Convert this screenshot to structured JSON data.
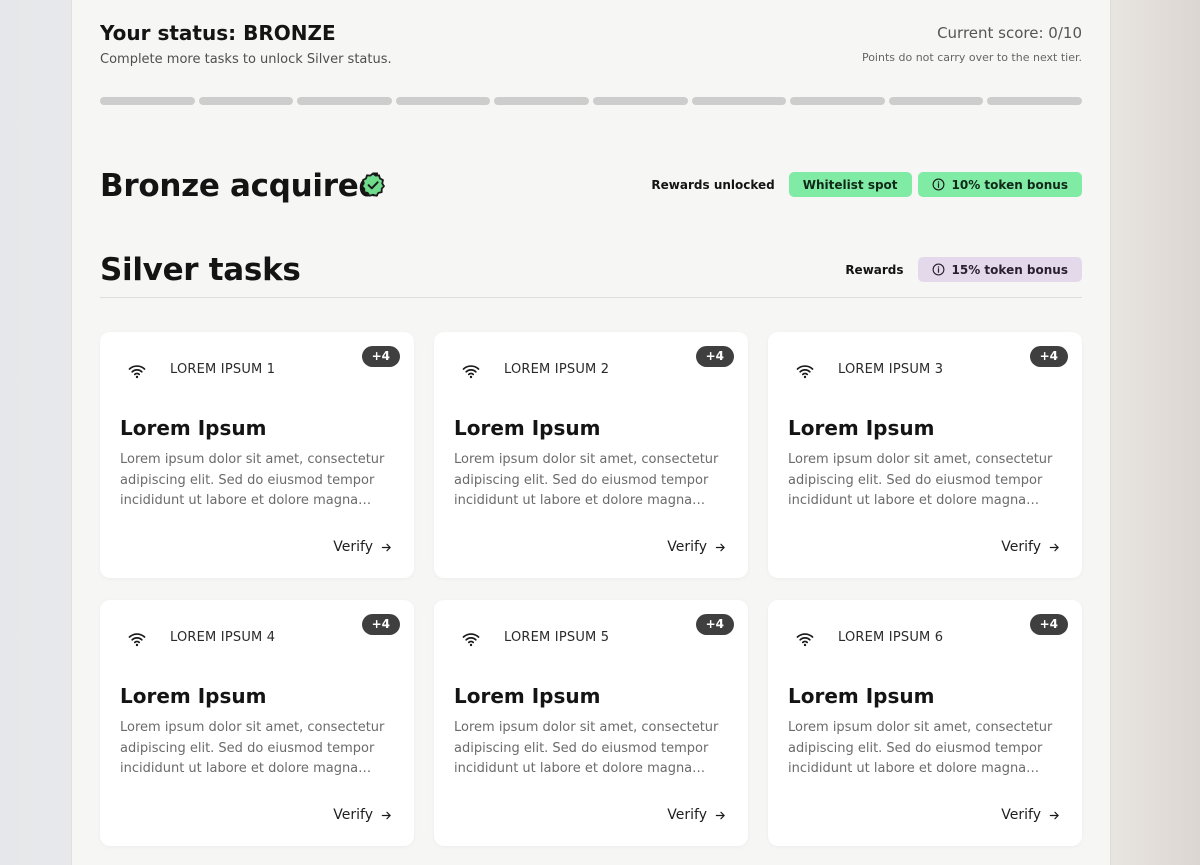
{
  "status": {
    "title": "Your status: BRONZE",
    "subtitle": "Complete more tasks to unlock Silver status.",
    "score": "Current score: 0/10",
    "note": "Points do not carry over to the next tier.",
    "progress": {
      "filled": 0,
      "total": 10
    }
  },
  "bronze": {
    "title": "Bronze acquired",
    "rewards_label": "Rewards unlocked",
    "rewards": [
      "Whitelist spot",
      "10% token bonus"
    ]
  },
  "silver": {
    "title": "Silver tasks",
    "rewards_label": "Rewards",
    "reward": "15% token bonus"
  },
  "tasks": [
    {
      "label": "LOREM IPSUM 1",
      "badge": "+4",
      "title": "Lorem Ipsum",
      "description": "Lorem ipsum dolor sit amet, consectetur adipiscing elit. Sed do eiusmod tempor incididunt ut labore et dolore magna aliqua.",
      "action": "Verify",
      "icon": "wifi-icon"
    },
    {
      "label": "LOREM IPSUM 2",
      "badge": "+4",
      "title": "Lorem Ipsum",
      "description": "Lorem ipsum dolor sit amet, consectetur adipiscing elit. Sed do eiusmod tempor incididunt ut labore et dolore magna aliqua.",
      "action": "Verify",
      "icon": "wifi-icon"
    },
    {
      "label": "LOREM IPSUM 3",
      "badge": "+4",
      "title": "Lorem Ipsum",
      "description": "Lorem ipsum dolor sit amet, consectetur adipiscing elit. Sed do eiusmod tempor incididunt ut labore et dolore magna aliqua.",
      "action": "Verify",
      "icon": "wifi-icon"
    },
    {
      "label": "LOREM IPSUM 4",
      "badge": "+4",
      "title": "Lorem Ipsum",
      "description": "Lorem ipsum dolor sit amet, consectetur adipiscing elit. Sed do eiusmod tempor incididunt ut labore et dolore magna aliqua.",
      "action": "Verify",
      "icon": "wifi-icon"
    },
    {
      "label": "LOREM IPSUM 5",
      "badge": "+4",
      "title": "Lorem Ipsum",
      "description": "Lorem ipsum dolor sit amet, consectetur adipiscing elit. Sed do eiusmod tempor incididunt ut labore et dolore magna aliqua.",
      "action": "Verify",
      "icon": "wifi-icon"
    },
    {
      "label": "LOREM IPSUM 6",
      "badge": "+4",
      "title": "Lorem Ipsum",
      "description": "Lorem ipsum dolor sit amet, consectetur adipiscing elit. Sed do eiusmod tempor incididunt ut labore et dolore magna aliqua.",
      "action": "Verify",
      "icon": "wifi-icon"
    }
  ],
  "colors": {
    "reward_green": "#80eba5",
    "reward_purple": "#e4d9ea",
    "badge_dark": "#3f3f3f",
    "progress_empty": "#cdcdcd",
    "check_green": "#6fdc8c"
  }
}
